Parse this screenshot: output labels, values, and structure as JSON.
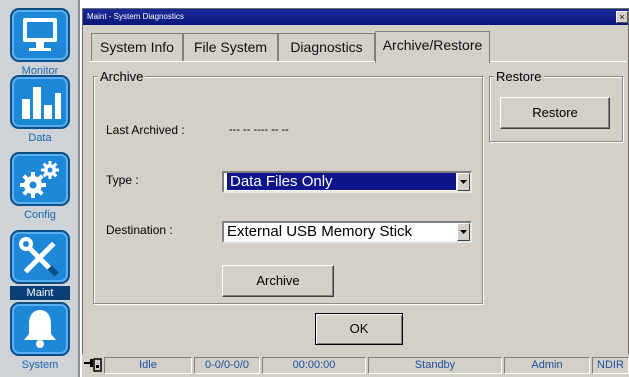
{
  "nav": {
    "items": [
      {
        "label": "Monitor",
        "icon": "monitor-icon"
      },
      {
        "label": "Data",
        "icon": "bar-chart-icon"
      },
      {
        "label": "Config",
        "icon": "gears-icon"
      },
      {
        "label": "Maint",
        "icon": "wrench-screwdriver-icon",
        "active": true
      },
      {
        "label": "System",
        "icon": "bell-icon"
      }
    ]
  },
  "window": {
    "title": "Maint - System Diagnostics",
    "close_label": "×"
  },
  "tabs": [
    "System Info",
    "File System",
    "Diagnostics",
    "Archive/Restore"
  ],
  "active_tab": "Archive/Restore",
  "archive": {
    "legend": "Archive",
    "last_archived_label": "Last Archived :",
    "last_archived_value": "--- -- ---- -- --",
    "type_label": "Type :",
    "type_value": "Data Files Only",
    "destination_label": "Destination :",
    "destination_value": "External USB Memory Stick",
    "archive_button": "Archive"
  },
  "restore": {
    "legend": "Restore",
    "restore_button": "Restore"
  },
  "ok_button": "OK",
  "status_bar": {
    "icon": "network-plug-icon",
    "state": "Idle",
    "counter": "0-0/0-0/0",
    "time": "00:00:00",
    "mode": "Standby",
    "user": "Admin",
    "sensor": "NDIR"
  },
  "colors": {
    "nav_tile": "#1e87d8",
    "title_bar": "#0a1779",
    "selection": "#10148a",
    "status_text": "#1a4fa0"
  }
}
